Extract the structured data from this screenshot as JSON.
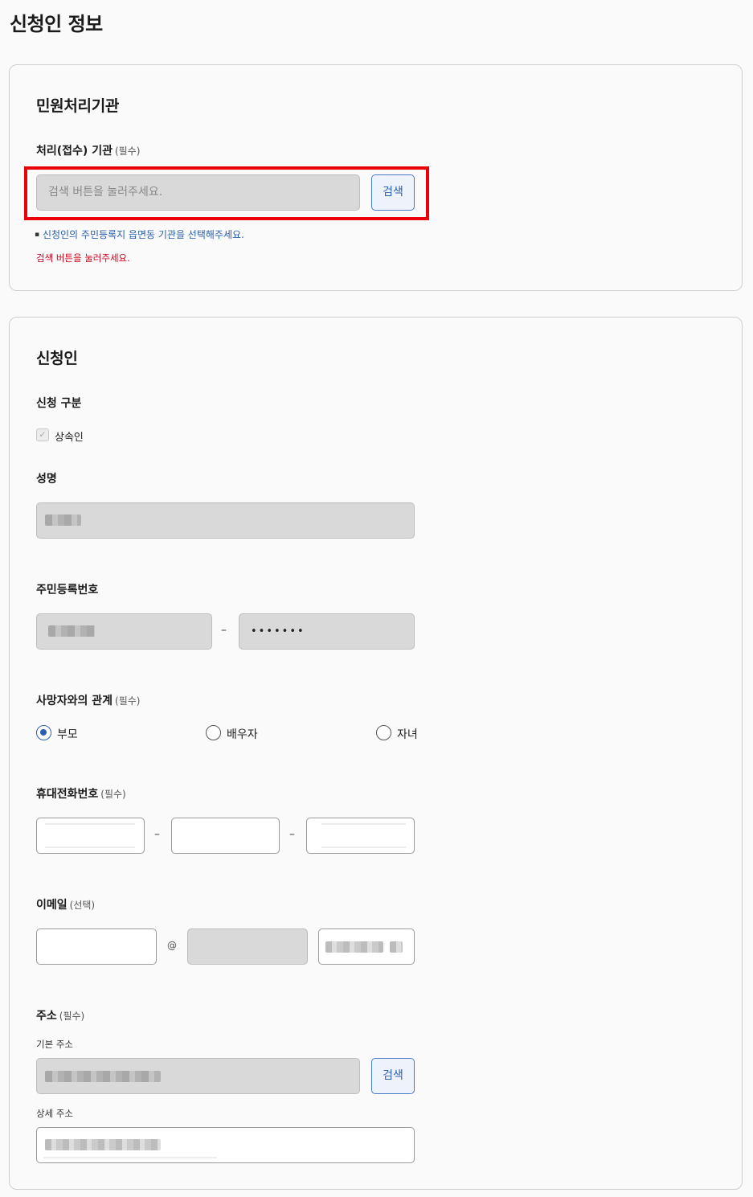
{
  "page": {
    "title": "신청인 정보"
  },
  "agency": {
    "title": "민원처리기관",
    "field_label": "처리(접수) 기관",
    "field_hint": "(필수)",
    "input_placeholder": "검색 버튼을 눌러주세요.",
    "search_label": "검색",
    "note": "신청인의 주민등록지 읍면동 기관을 선택해주세요.",
    "error": "검색 버튼을 눌러주세요."
  },
  "applicant": {
    "title": "신청인",
    "type_label": "신청 구분",
    "type_option": "상속인",
    "name_label": "성명",
    "rrn_label": "주민등록번호",
    "rrn_masked": "•••••••",
    "relation_label": "사망자와의 관계",
    "relation_hint": "(필수)",
    "relation_options": [
      "부모",
      "배우자",
      "자녀"
    ],
    "phone_label": "휴대전화번호",
    "phone_hint": "(필수)",
    "email_label": "이메일",
    "email_hint": "(선택)",
    "email_at": "@",
    "address_label": "주소",
    "address_hint": "(필수)",
    "base_address_label": "기본 주소",
    "detail_address_label": "상세 주소",
    "address_search_label": "검색",
    "dash": "–"
  },
  "colors": {
    "accent": "#2b5fad",
    "error": "#d0021b",
    "highlight": "#e8000b"
  },
  "icons": {
    "check": "check-icon",
    "bullet": "bullet-icon"
  }
}
